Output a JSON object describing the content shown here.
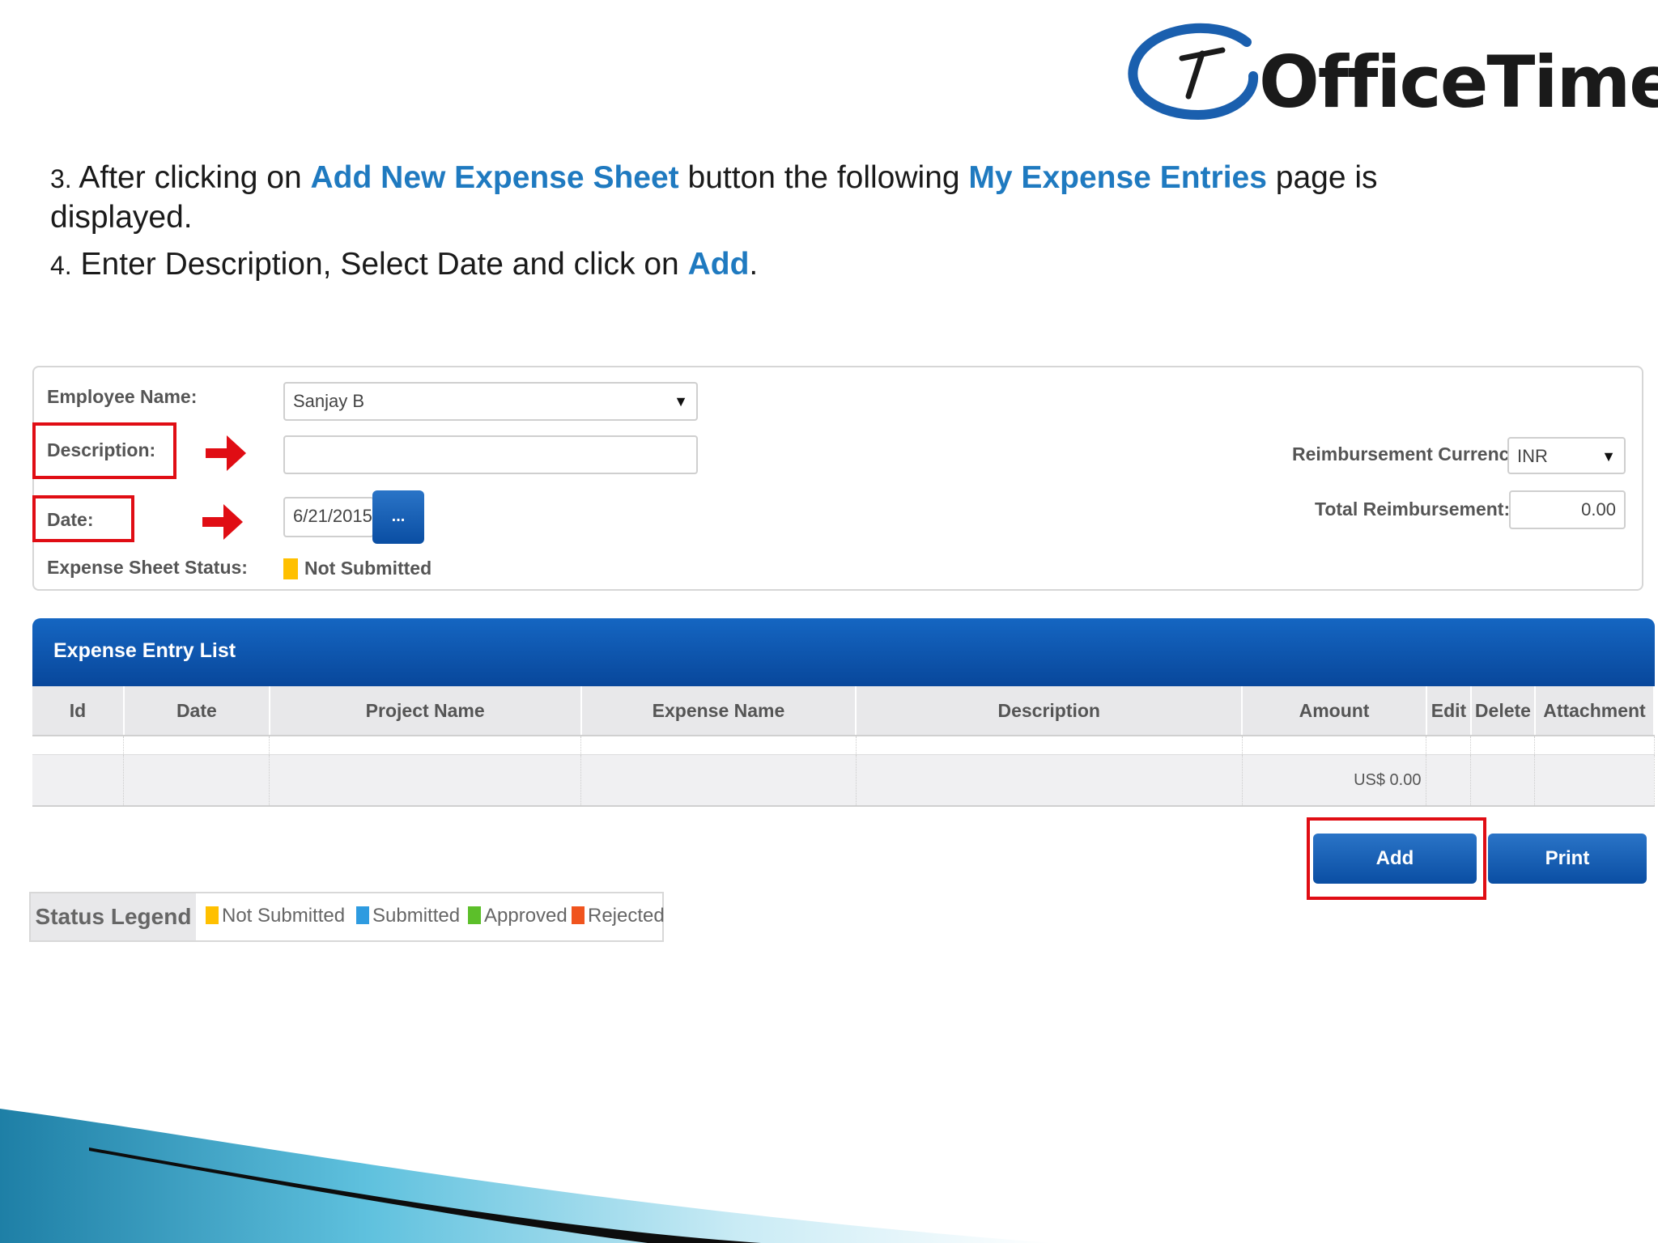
{
  "brand": {
    "name": "OfficeTimer"
  },
  "instructions": {
    "step3": {
      "num": "3.",
      "t1": "After clicking on",
      "hl1": "Add New Expense Sheet",
      "t2": "button the  following",
      "hl2": "My Expense Entries",
      "t3": "page is displayed."
    },
    "step4": {
      "num": "4.",
      "t1": "Enter Description, Select Date and click on",
      "hl1": "Add",
      "t2": "."
    }
  },
  "form": {
    "employee_label": "Employee Name:",
    "employee_value": "Sanjay B",
    "description_label": "Description:",
    "description_value": "",
    "date_label": "Date:",
    "date_value": "6/21/2015",
    "calendar_button": "...",
    "status_label": "Expense Sheet Status:",
    "status_value": "Not Submitted",
    "currency_label": "Reimbursement Currency:",
    "currency_value": "INR",
    "total_label": "Total Reimbursement:",
    "total_value": "0.00"
  },
  "table": {
    "title": "Expense Entry List",
    "columns": [
      "Id",
      "Date",
      "Project Name",
      "Expense Name",
      "Description",
      "Amount",
      "Edit",
      "Delete",
      "Attachment"
    ],
    "total_amount": "US$ 0.00"
  },
  "buttons": {
    "add": "Add",
    "print": "Print"
  },
  "legend": {
    "title": "Status Legend",
    "items": [
      {
        "label": "Not Submitted",
        "color": "#ffc000"
      },
      {
        "label": "Submitted",
        "color": "#2e9be0"
      },
      {
        "label": "Approved",
        "color": "#5cbf2a"
      },
      {
        "label": "Rejected",
        "color": "#f0541e"
      }
    ]
  },
  "colors": {
    "accent": "#1f7ac0",
    "highlight": "#e00d14",
    "header_blue": "#0b4fa3"
  }
}
